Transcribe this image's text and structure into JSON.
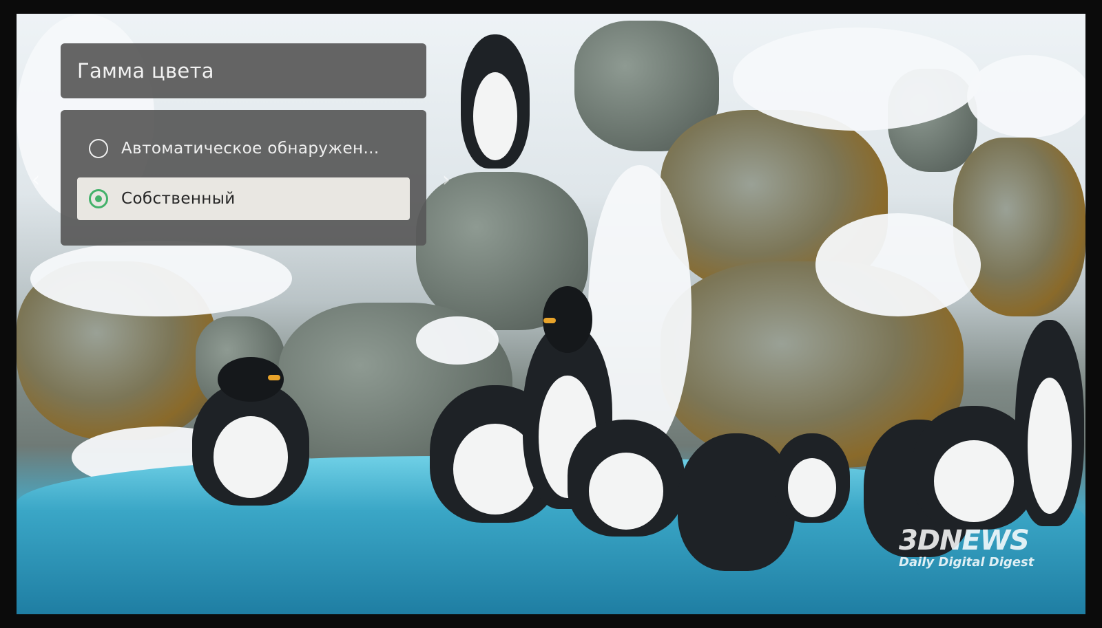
{
  "menu": {
    "title": "Гамма цвета",
    "options": [
      {
        "label": "Автоматическое обнаружен...",
        "selected": false
      },
      {
        "label": "Собственный",
        "selected": true
      }
    ]
  },
  "colors": {
    "panel": "#585858",
    "selected_bg": "#e9e7e2",
    "radio_selected": "#43b16a"
  },
  "navigation": {
    "left_arrow": "chevron-left-icon",
    "right_arrow": "chevron-right-icon"
  },
  "watermark": {
    "logo": "3DNEWS",
    "tagline": "Daily Digital Digest"
  }
}
